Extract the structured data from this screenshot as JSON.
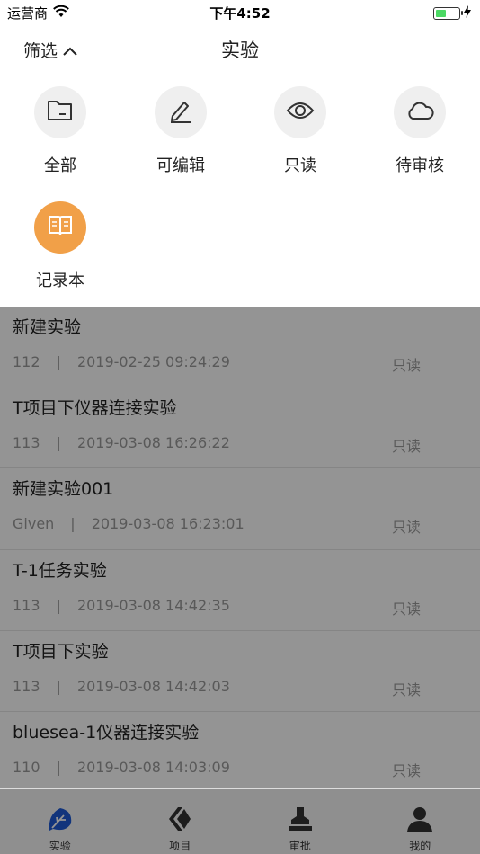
{
  "status_bar": {
    "carrier": "运营商",
    "time": "下午4:52"
  },
  "nav": {
    "filter_label": "筛选",
    "title": "实验"
  },
  "filter_options": [
    {
      "label": "全部",
      "icon": "folder-icon"
    },
    {
      "label": "可编辑",
      "icon": "pencil-icon"
    },
    {
      "label": "只读",
      "icon": "eye-icon"
    },
    {
      "label": "待审核",
      "icon": "cloud-icon"
    },
    {
      "label": "记录本",
      "icon": "notebook-icon",
      "active_color": "#f1a048"
    }
  ],
  "experiments": [
    {
      "title": "新建实验",
      "owner": "112",
      "date": "2019-02-25 09:24:29",
      "status": "只读"
    },
    {
      "title": "T项目下仪器连接实验",
      "owner": "113",
      "date": "2019-03-08 16:26:22",
      "status": "只读"
    },
    {
      "title": "新建实验001",
      "owner": "Given",
      "date": "2019-03-08 16:23:01",
      "status": "只读"
    },
    {
      "title": "T-1任务实验",
      "owner": "113",
      "date": "2019-03-08 14:42:35",
      "status": "只读"
    },
    {
      "title": "T项目下实验",
      "owner": "113",
      "date": "2019-03-08 14:42:03",
      "status": "只读"
    },
    {
      "title": "bluesea-1仪器连接实验",
      "owner": "110",
      "date": "2019-03-08 14:03:09",
      "status": "只读"
    }
  ],
  "separator": "|",
  "tabs": [
    {
      "label": "实验",
      "icon": "leaf-icon",
      "active": true
    },
    {
      "label": "项目",
      "icon": "layers-icon",
      "active": false
    },
    {
      "label": "审批",
      "icon": "stamp-icon",
      "active": false
    },
    {
      "label": "我的",
      "icon": "person-icon",
      "active": false
    }
  ],
  "colors": {
    "accent": "#f1a048",
    "tab_active": "#1e5bd6"
  }
}
